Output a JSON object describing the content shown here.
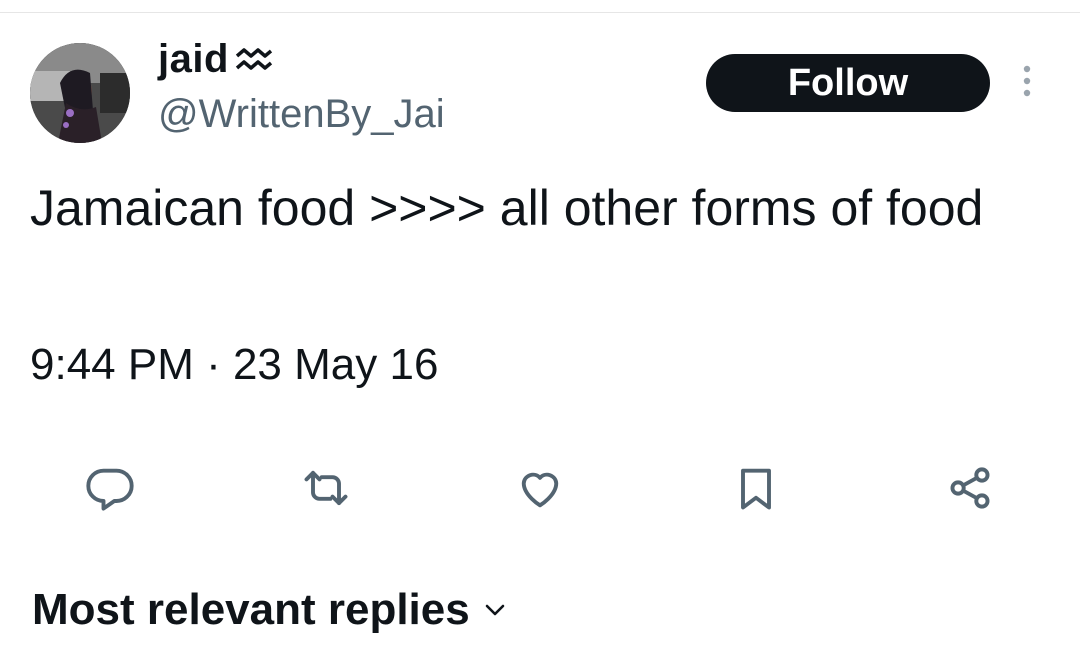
{
  "user": {
    "display_name": "jaid",
    "name_emoji": "aquarius-icon",
    "handle": "@WrittenBy_Jai"
  },
  "follow_label": "Follow",
  "tweet": {
    "text": "Jamaican food >>>> all other forms of food",
    "timestamp": "9:44 PM · 23 May 16"
  },
  "actions": [
    "reply-icon",
    "retweet-icon",
    "like-icon",
    "bookmark-icon",
    "share-icon"
  ],
  "replies_sort_label": "Most relevant replies",
  "colors": {
    "text": "#0f1419",
    "secondary": "#536471",
    "button_bg": "#0f1419",
    "button_text": "#ffffff"
  }
}
